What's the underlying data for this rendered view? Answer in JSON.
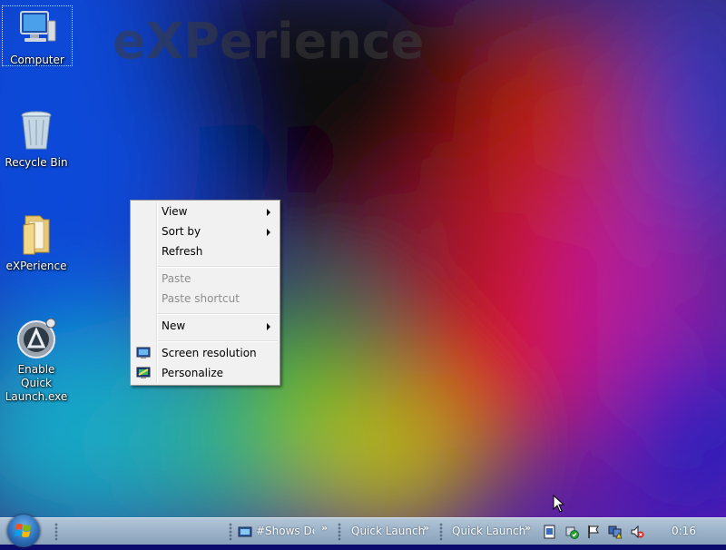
{
  "desktop": {
    "watermark": "eXPerience",
    "icons": [
      {
        "label": "Computer"
      },
      {
        "label": "Recycle Bin"
      },
      {
        "label": "eXPerience"
      },
      {
        "label": "Enable Quick Launch.exe"
      }
    ]
  },
  "context_menu": {
    "items": [
      {
        "label": "View",
        "has_submenu": true,
        "enabled": true
      },
      {
        "label": "Sort by",
        "has_submenu": true,
        "enabled": true
      },
      {
        "label": "Refresh",
        "has_submenu": false,
        "enabled": true
      },
      {
        "label": "Paste",
        "has_submenu": false,
        "enabled": false
      },
      {
        "label": "Paste shortcut",
        "has_submenu": false,
        "enabled": false
      },
      {
        "label": "New",
        "has_submenu": true,
        "enabled": true
      },
      {
        "label": "Screen resolution",
        "has_submenu": false,
        "enabled": true,
        "icon": "monitor-icon"
      },
      {
        "label": "Personalize",
        "has_submenu": false,
        "enabled": true,
        "icon": "personalize-icon"
      }
    ]
  },
  "taskbar": {
    "show_desktop": "#Shows Desl",
    "toolbar_1": "Quick Launch",
    "toolbar_2": "Quick Launch",
    "chevron": "»",
    "clock": "0:16"
  },
  "colors": {
    "taskbar": "#9eb4c9",
    "menu_bg": "#f1f1f1",
    "menu_disabled_text": "#8d8d8d"
  }
}
